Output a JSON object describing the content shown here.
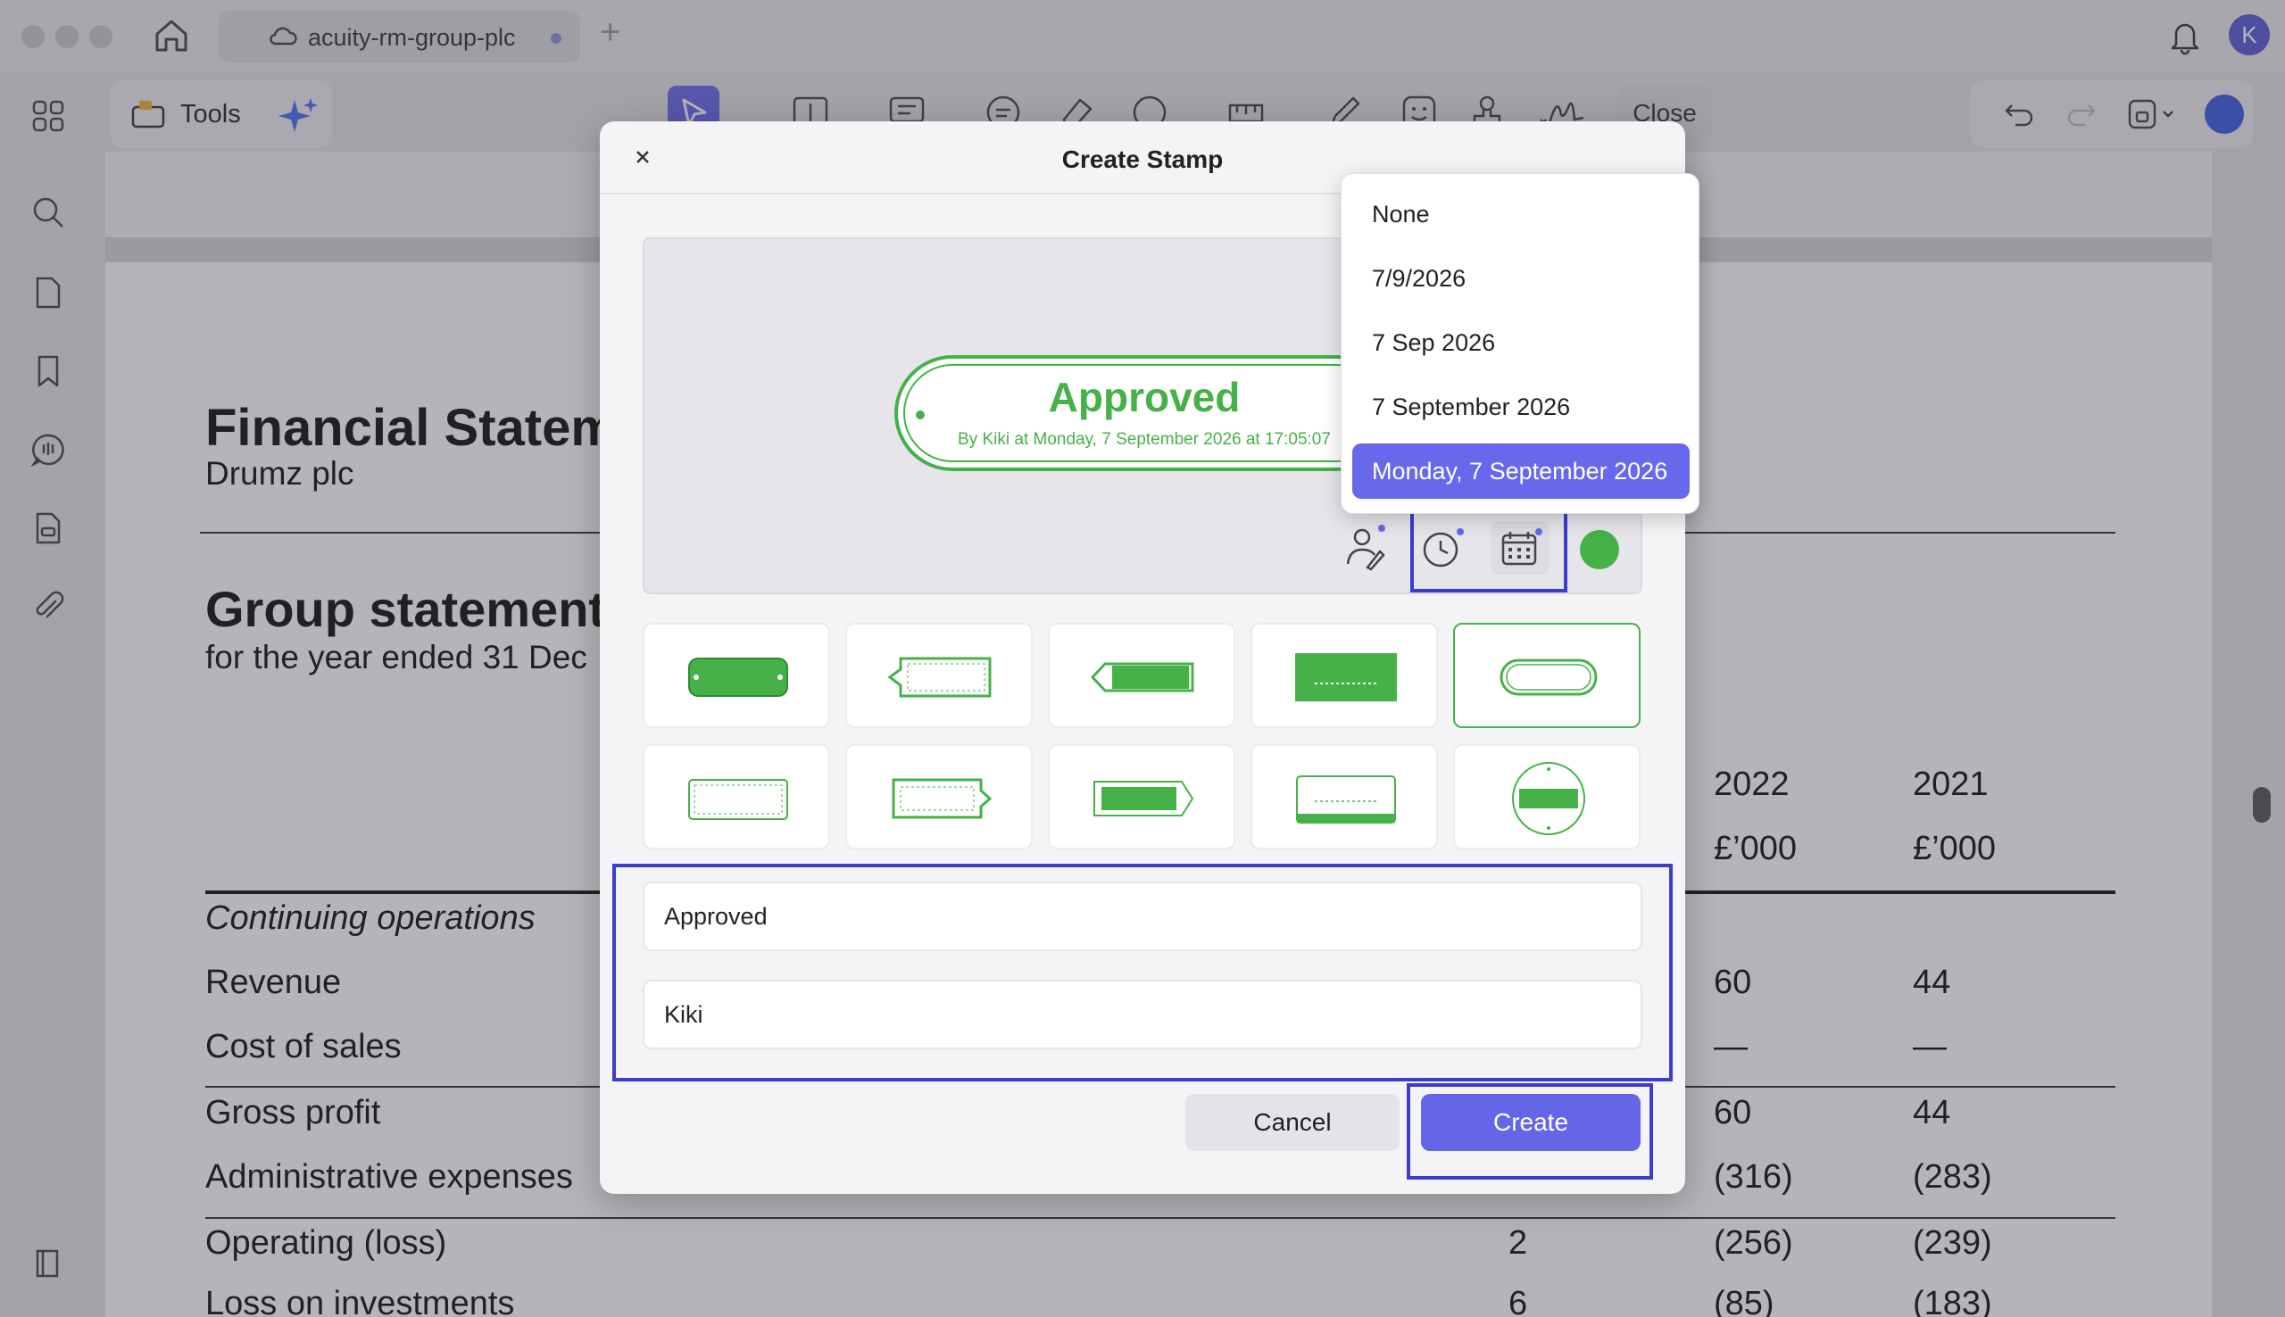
{
  "tab": {
    "title": "acuity-rm-group-plc"
  },
  "user": {
    "initial": "K"
  },
  "toolbar": {
    "tools_label": "Tools",
    "close_label": "Close"
  },
  "document": {
    "heading1": "Financial Statem",
    "company": "Drumz plc",
    "heading2": "Group statement",
    "period": "for the year ended 31 Dec",
    "col_2022": "2022",
    "col_2021": "2021",
    "unit_2022": "£’000",
    "unit_2021": "£’000",
    "section": "Continuing operations",
    "rows": [
      {
        "label": "Revenue",
        "note": "",
        "v2022": "60",
        "v2021": "44"
      },
      {
        "label": "Cost of sales",
        "note": "",
        "v2022": "—",
        "v2021": "—"
      },
      {
        "label": "Gross profit",
        "note": "",
        "v2022": "60",
        "v2021": "44"
      },
      {
        "label": "Administrative expenses",
        "note": "",
        "v2022": "(316)",
        "v2021": "(283)"
      },
      {
        "label": "Operating (loss)",
        "note": "2",
        "v2022": "(256)",
        "v2021": "(239)"
      },
      {
        "label": "Loss on investments",
        "note": "6",
        "v2022": "(85)",
        "v2021": "(183)"
      }
    ]
  },
  "dialog": {
    "title": "Create Stamp",
    "stamp_preview": {
      "title": "Approved",
      "subtitle": "By Kiki at Monday, 7 September 2026 at 17:05:07"
    },
    "stamp_color": "#46b148",
    "text_value": "Approved",
    "author_value": "Kiki",
    "cancel_label": "Cancel",
    "create_label": "Create"
  },
  "date_dropdown": {
    "options": [
      "None",
      "7/9/2026",
      "7 Sep 2026",
      "7 September 2026",
      "Monday, 7 September 2026"
    ],
    "selected": "Monday, 7 September 2026"
  },
  "colors": {
    "accent": "#6565e8",
    "highlight": "#3c3ccf",
    "stamp_green": "#46b148"
  }
}
